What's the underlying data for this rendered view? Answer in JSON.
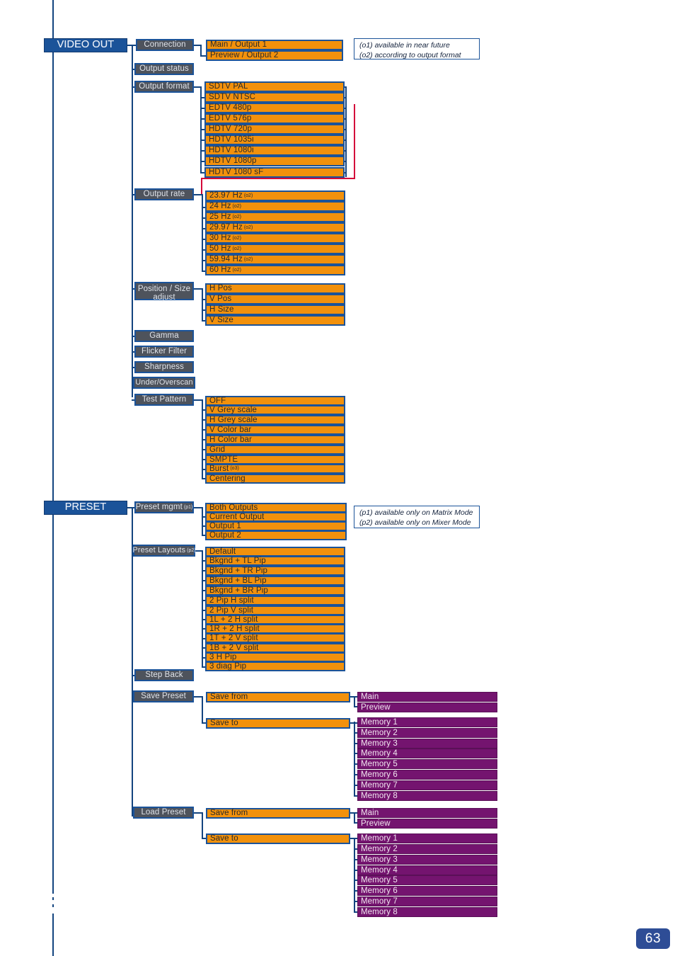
{
  "page": {
    "number": "63"
  },
  "sections": [
    {
      "id": "video-out",
      "title": "VIDEO OUT",
      "menus": [
        {
          "id": "connection",
          "label": "Connection",
          "items": [
            "Main / Output 1",
            "Preview / Output 2"
          ]
        },
        {
          "id": "output-status",
          "label": "Output status",
          "items": []
        },
        {
          "id": "output-format",
          "label": "Output format",
          "items": [
            "SDTV PAL",
            "SDTV NTSC",
            "EDTV 480p",
            "EDTV 576p",
            "HDTV 720p",
            "HDTV 1035i",
            "HDTV 1080i",
            "HDTV 1080p",
            "HDTV 1080 sF"
          ]
        },
        {
          "id": "output-rate",
          "label": "Output rate",
          "items": [
            "23.97 Hz",
            "24 Hz",
            "25 Hz",
            "29.97 Hz",
            "30 Hz",
            "50 Hz",
            "59.94 Hz",
            "60 Hz"
          ],
          "item_sup": "(o2)"
        },
        {
          "id": "position-size-adjust",
          "label": "Position / Size adjust",
          "label_line1": "Position / Size",
          "label_line2": "adjust",
          "items": [
            "H Pos",
            "V Pos",
            "H Size",
            "V Size"
          ]
        },
        {
          "id": "gamma",
          "label": "Gamma",
          "items": []
        },
        {
          "id": "flicker-filter",
          "label": "Flicker Filter",
          "items": []
        },
        {
          "id": "sharpness",
          "label": "Sharpness",
          "items": []
        },
        {
          "id": "under-overscan",
          "label": "Under/Overscan",
          "items": []
        },
        {
          "id": "test-pattern",
          "label": "Test Pattern",
          "items": [
            "OFF",
            "V Grey scale",
            "H Grey scale",
            "V Color bar",
            "H Color bar",
            "Grid",
            "SMPTE",
            "Burst",
            "Centering"
          ],
          "item_sup_index": 7,
          "item_sup": "(o3)"
        }
      ],
      "notes": [
        "(o1) available in near future",
        "(o2) according to output format"
      ]
    },
    {
      "id": "preset",
      "title": "PRESET",
      "menus": [
        {
          "id": "preset-mgmt",
          "label": "Preset mgmt",
          "label_sup": "(p1)",
          "items": [
            "Both Outputs",
            "Current Output",
            "Output 1",
            "Output 2"
          ]
        },
        {
          "id": "preset-layouts",
          "label": "Preset Layouts",
          "label_sup": "(p2)",
          "items": [
            "Default",
            "Bkgnd + TL Pip",
            "Bkgnd + TR Pip",
            "Bkgnd + BL Pip",
            "Bkgnd + BR Pip",
            "2 Pip H split",
            "2 Pip V split",
            "1L + 2 H split",
            "1R + 2 H split",
            "1T + 2 V split",
            "1B + 2 V split",
            "3 H Pip",
            "3 diag Pip"
          ]
        },
        {
          "id": "step-back",
          "label": "Step Back",
          "items": []
        },
        {
          "id": "save-preset",
          "label": "Save Preset",
          "items": [
            "Save from",
            "Save to"
          ],
          "sub_from": [
            "Main",
            "Preview"
          ],
          "sub_to": [
            "Memory 1",
            "Memory 2",
            "Memory 3",
            "Memory 4",
            "Memory 5",
            "Memory 6",
            "Memory 7",
            "Memory 8"
          ]
        },
        {
          "id": "load-preset",
          "label": "Load Preset",
          "items": [
            "Save from",
            "Save to"
          ],
          "sub_from": [
            "Main",
            "Preview"
          ],
          "sub_to": [
            "Memory 1",
            "Memory 2",
            "Memory 3",
            "Memory 4",
            "Memory 5",
            "Memory 6",
            "Memory 7",
            "Memory 8"
          ]
        }
      ],
      "notes": [
        "(p1) available only on Matrix Mode",
        "(p2) available only on Mixer Mode"
      ]
    }
  ],
  "colors": {
    "banner": "#1B5399",
    "gray_box": "#4E535C",
    "orange_box": "#F2910C",
    "purple_box": "#74146F",
    "connector": "#13447F",
    "highlight_red": "#D4063A",
    "page_badge": "#2E4D96"
  }
}
